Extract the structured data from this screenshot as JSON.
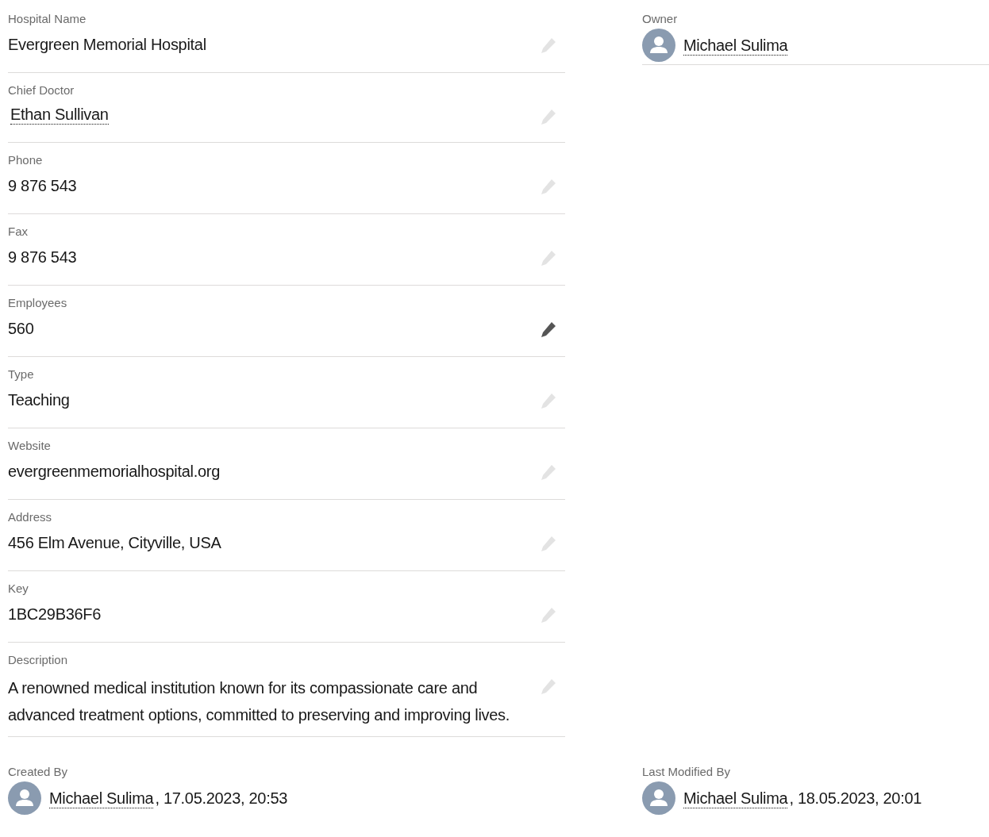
{
  "fields": [
    {
      "label": "Hospital Name",
      "value": "Evergreen Memorial Hospital",
      "kind": "text",
      "highlighted": false
    },
    {
      "label": "Chief Doctor",
      "value": "Ethan Sullivan",
      "kind": "link",
      "highlighted": false
    },
    {
      "label": "Phone",
      "value": "9 876 543",
      "kind": "text",
      "highlighted": false
    },
    {
      "label": "Fax",
      "value": "9 876 543",
      "kind": "text",
      "highlighted": false
    },
    {
      "label": "Employees",
      "value": "560",
      "kind": "text",
      "highlighted": true
    },
    {
      "label": "Type",
      "value": "Teaching",
      "kind": "text",
      "highlighted": false
    },
    {
      "label": "Website",
      "value": "evergreenmemorialhospital.org",
      "kind": "text",
      "highlighted": false
    },
    {
      "label": "Address",
      "value": "456 Elm Avenue, Cityville, USA",
      "kind": "text",
      "highlighted": false
    },
    {
      "label": "Key",
      "value": "1BC29B36F6",
      "kind": "text",
      "highlighted": false
    },
    {
      "label": "Description",
      "value": "A renowned medical institution known for its compassionate care and advanced treatment options, committed to preserving and improving lives.",
      "kind": "text",
      "highlighted": false
    }
  ],
  "owner": {
    "label": "Owner",
    "name": "Michael Sulima"
  },
  "created": {
    "label": "Created By",
    "name": "Michael Sulima",
    "date": ", 17.05.2023, 20:53"
  },
  "modified": {
    "label": "Last Modified By",
    "name": "Michael Sulima",
    "date": ", 18.05.2023, 20:01"
  }
}
